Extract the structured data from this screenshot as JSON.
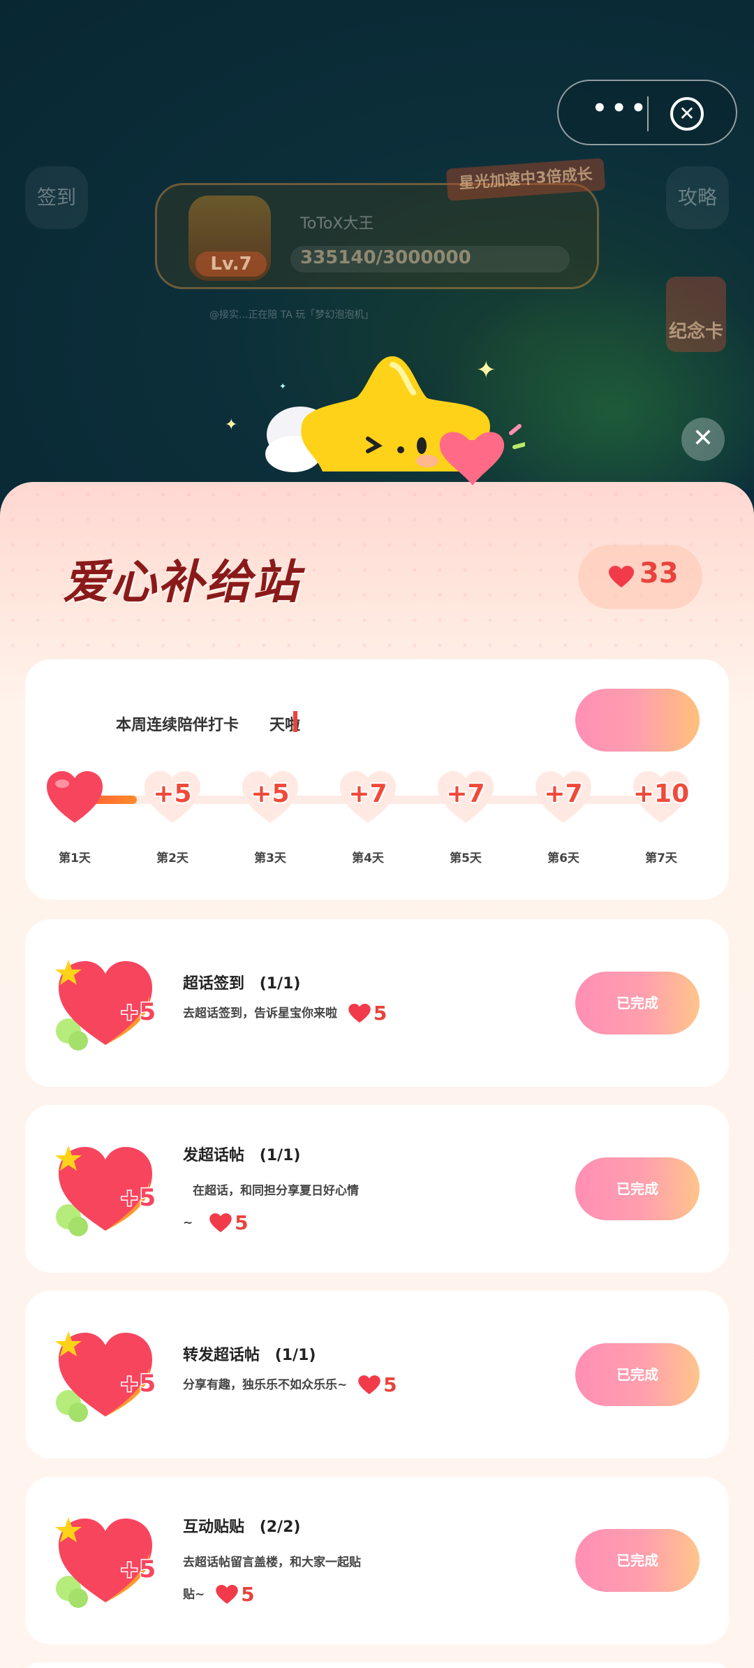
{
  "background": {
    "capsule": {
      "more_label": "•••",
      "close_label": "✕"
    },
    "left_button": "签到",
    "right_button": "攻略",
    "ribbon": "星光加速中3倍成长",
    "level": "Lv.7",
    "username": "ToToX大王",
    "progress_text": "335140/3000000",
    "notice": "@接实...正在陪 TA 玩「梦幻泡泡机」",
    "card_label": "纪念卡"
  },
  "popup": {
    "close_label": "✕",
    "title": "爱心补给站",
    "balance": "33",
    "streak": {
      "text": "本周连续陪伴打卡",
      "suffix": "天啦",
      "days": [
        {
          "label": "第1天",
          "value": ""
        },
        {
          "label": "第2天",
          "value": "+5"
        },
        {
          "label": "第3天",
          "value": "+5"
        },
        {
          "label": "第4天",
          "value": "+7"
        },
        {
          "label": "第5天",
          "value": "+7"
        },
        {
          "label": "第6天",
          "value": "+7"
        },
        {
          "label": "第7天",
          "value": "+10"
        }
      ]
    },
    "tasks": [
      {
        "title": "超话签到",
        "progress": "(1/1)",
        "desc": "去超话签到，告诉星宝你来啦",
        "desc2": "",
        "reward": "5",
        "icon_badge": "+5",
        "button": "已完成"
      },
      {
        "title": "发超话帖",
        "progress": "(1/1)",
        "desc": "在超话，和同担分享夏日好心情",
        "desc2": "~",
        "reward": "5",
        "icon_badge": "+5",
        "button": "已完成"
      },
      {
        "title": "转发超话帖",
        "progress": "(1/1)",
        "desc": "分享有趣，独乐乐不如众乐乐~",
        "desc2": "",
        "reward": "5",
        "icon_badge": "+5",
        "button": "已完成"
      },
      {
        "title": "互动贴贴",
        "progress": "(2/2)",
        "desc": "去超话帖留言盖楼，和大家一起贴",
        "desc2": "贴~",
        "reward": "5",
        "icon_badge": "+5",
        "button": "已完成"
      }
    ]
  }
}
